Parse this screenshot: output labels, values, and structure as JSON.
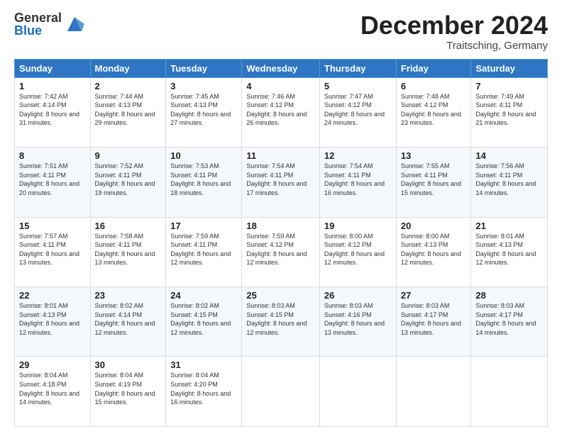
{
  "logo": {
    "general": "General",
    "blue": "Blue"
  },
  "title": "December 2024",
  "location": "Traitsching, Germany",
  "days_of_week": [
    "Sunday",
    "Monday",
    "Tuesday",
    "Wednesday",
    "Thursday",
    "Friday",
    "Saturday"
  ],
  "weeks": [
    [
      {
        "day": "1",
        "info": "Sunrise: 7:42 AM\nSunset: 4:14 PM\nDaylight: 8 hours and 31 minutes."
      },
      {
        "day": "2",
        "info": "Sunrise: 7:44 AM\nSunset: 4:13 PM\nDaylight: 8 hours and 29 minutes."
      },
      {
        "day": "3",
        "info": "Sunrise: 7:45 AM\nSunset: 4:13 PM\nDaylight: 8 hours and 27 minutes."
      },
      {
        "day": "4",
        "info": "Sunrise: 7:46 AM\nSunset: 4:12 PM\nDaylight: 8 hours and 26 minutes."
      },
      {
        "day": "5",
        "info": "Sunrise: 7:47 AM\nSunset: 4:12 PM\nDaylight: 8 hours and 24 minutes."
      },
      {
        "day": "6",
        "info": "Sunrise: 7:48 AM\nSunset: 4:12 PM\nDaylight: 8 hours and 23 minutes."
      },
      {
        "day": "7",
        "info": "Sunrise: 7:49 AM\nSunset: 4:11 PM\nDaylight: 8 hours and 21 minutes."
      }
    ],
    [
      {
        "day": "8",
        "info": "Sunrise: 7:51 AM\nSunset: 4:11 PM\nDaylight: 8 hours and 20 minutes."
      },
      {
        "day": "9",
        "info": "Sunrise: 7:52 AM\nSunset: 4:11 PM\nDaylight: 8 hours and 19 minutes."
      },
      {
        "day": "10",
        "info": "Sunrise: 7:53 AM\nSunset: 4:11 PM\nDaylight: 8 hours and 18 minutes."
      },
      {
        "day": "11",
        "info": "Sunrise: 7:54 AM\nSunset: 4:11 PM\nDaylight: 8 hours and 17 minutes."
      },
      {
        "day": "12",
        "info": "Sunrise: 7:54 AM\nSunset: 4:11 PM\nDaylight: 8 hours and 16 minutes."
      },
      {
        "day": "13",
        "info": "Sunrise: 7:55 AM\nSunset: 4:11 PM\nDaylight: 8 hours and 15 minutes."
      },
      {
        "day": "14",
        "info": "Sunrise: 7:56 AM\nSunset: 4:11 PM\nDaylight: 8 hours and 14 minutes."
      }
    ],
    [
      {
        "day": "15",
        "info": "Sunrise: 7:57 AM\nSunset: 4:11 PM\nDaylight: 8 hours and 13 minutes."
      },
      {
        "day": "16",
        "info": "Sunrise: 7:58 AM\nSunset: 4:11 PM\nDaylight: 8 hours and 13 minutes."
      },
      {
        "day": "17",
        "info": "Sunrise: 7:59 AM\nSunset: 4:11 PM\nDaylight: 8 hours and 12 minutes."
      },
      {
        "day": "18",
        "info": "Sunrise: 7:59 AM\nSunset: 4:12 PM\nDaylight: 8 hours and 12 minutes."
      },
      {
        "day": "19",
        "info": "Sunrise: 8:00 AM\nSunset: 4:12 PM\nDaylight: 8 hours and 12 minutes."
      },
      {
        "day": "20",
        "info": "Sunrise: 8:00 AM\nSunset: 4:13 PM\nDaylight: 8 hours and 12 minutes."
      },
      {
        "day": "21",
        "info": "Sunrise: 8:01 AM\nSunset: 4:13 PM\nDaylight: 8 hours and 12 minutes."
      }
    ],
    [
      {
        "day": "22",
        "info": "Sunrise: 8:01 AM\nSunset: 4:13 PM\nDaylight: 8 hours and 12 minutes."
      },
      {
        "day": "23",
        "info": "Sunrise: 8:02 AM\nSunset: 4:14 PM\nDaylight: 8 hours and 12 minutes."
      },
      {
        "day": "24",
        "info": "Sunrise: 8:02 AM\nSunset: 4:15 PM\nDaylight: 8 hours and 12 minutes."
      },
      {
        "day": "25",
        "info": "Sunrise: 8:03 AM\nSunset: 4:15 PM\nDaylight: 8 hours and 12 minutes."
      },
      {
        "day": "26",
        "info": "Sunrise: 8:03 AM\nSunset: 4:16 PM\nDaylight: 8 hours and 13 minutes."
      },
      {
        "day": "27",
        "info": "Sunrise: 8:03 AM\nSunset: 4:17 PM\nDaylight: 8 hours and 13 minutes."
      },
      {
        "day": "28",
        "info": "Sunrise: 8:03 AM\nSunset: 4:17 PM\nDaylight: 8 hours and 14 minutes."
      }
    ],
    [
      {
        "day": "29",
        "info": "Sunrise: 8:04 AM\nSunset: 4:18 PM\nDaylight: 8 hours and 14 minutes."
      },
      {
        "day": "30",
        "info": "Sunrise: 8:04 AM\nSunset: 4:19 PM\nDaylight: 8 hours and 15 minutes."
      },
      {
        "day": "31",
        "info": "Sunrise: 8:04 AM\nSunset: 4:20 PM\nDaylight: 8 hours and 16 minutes."
      },
      null,
      null,
      null,
      null
    ]
  ]
}
